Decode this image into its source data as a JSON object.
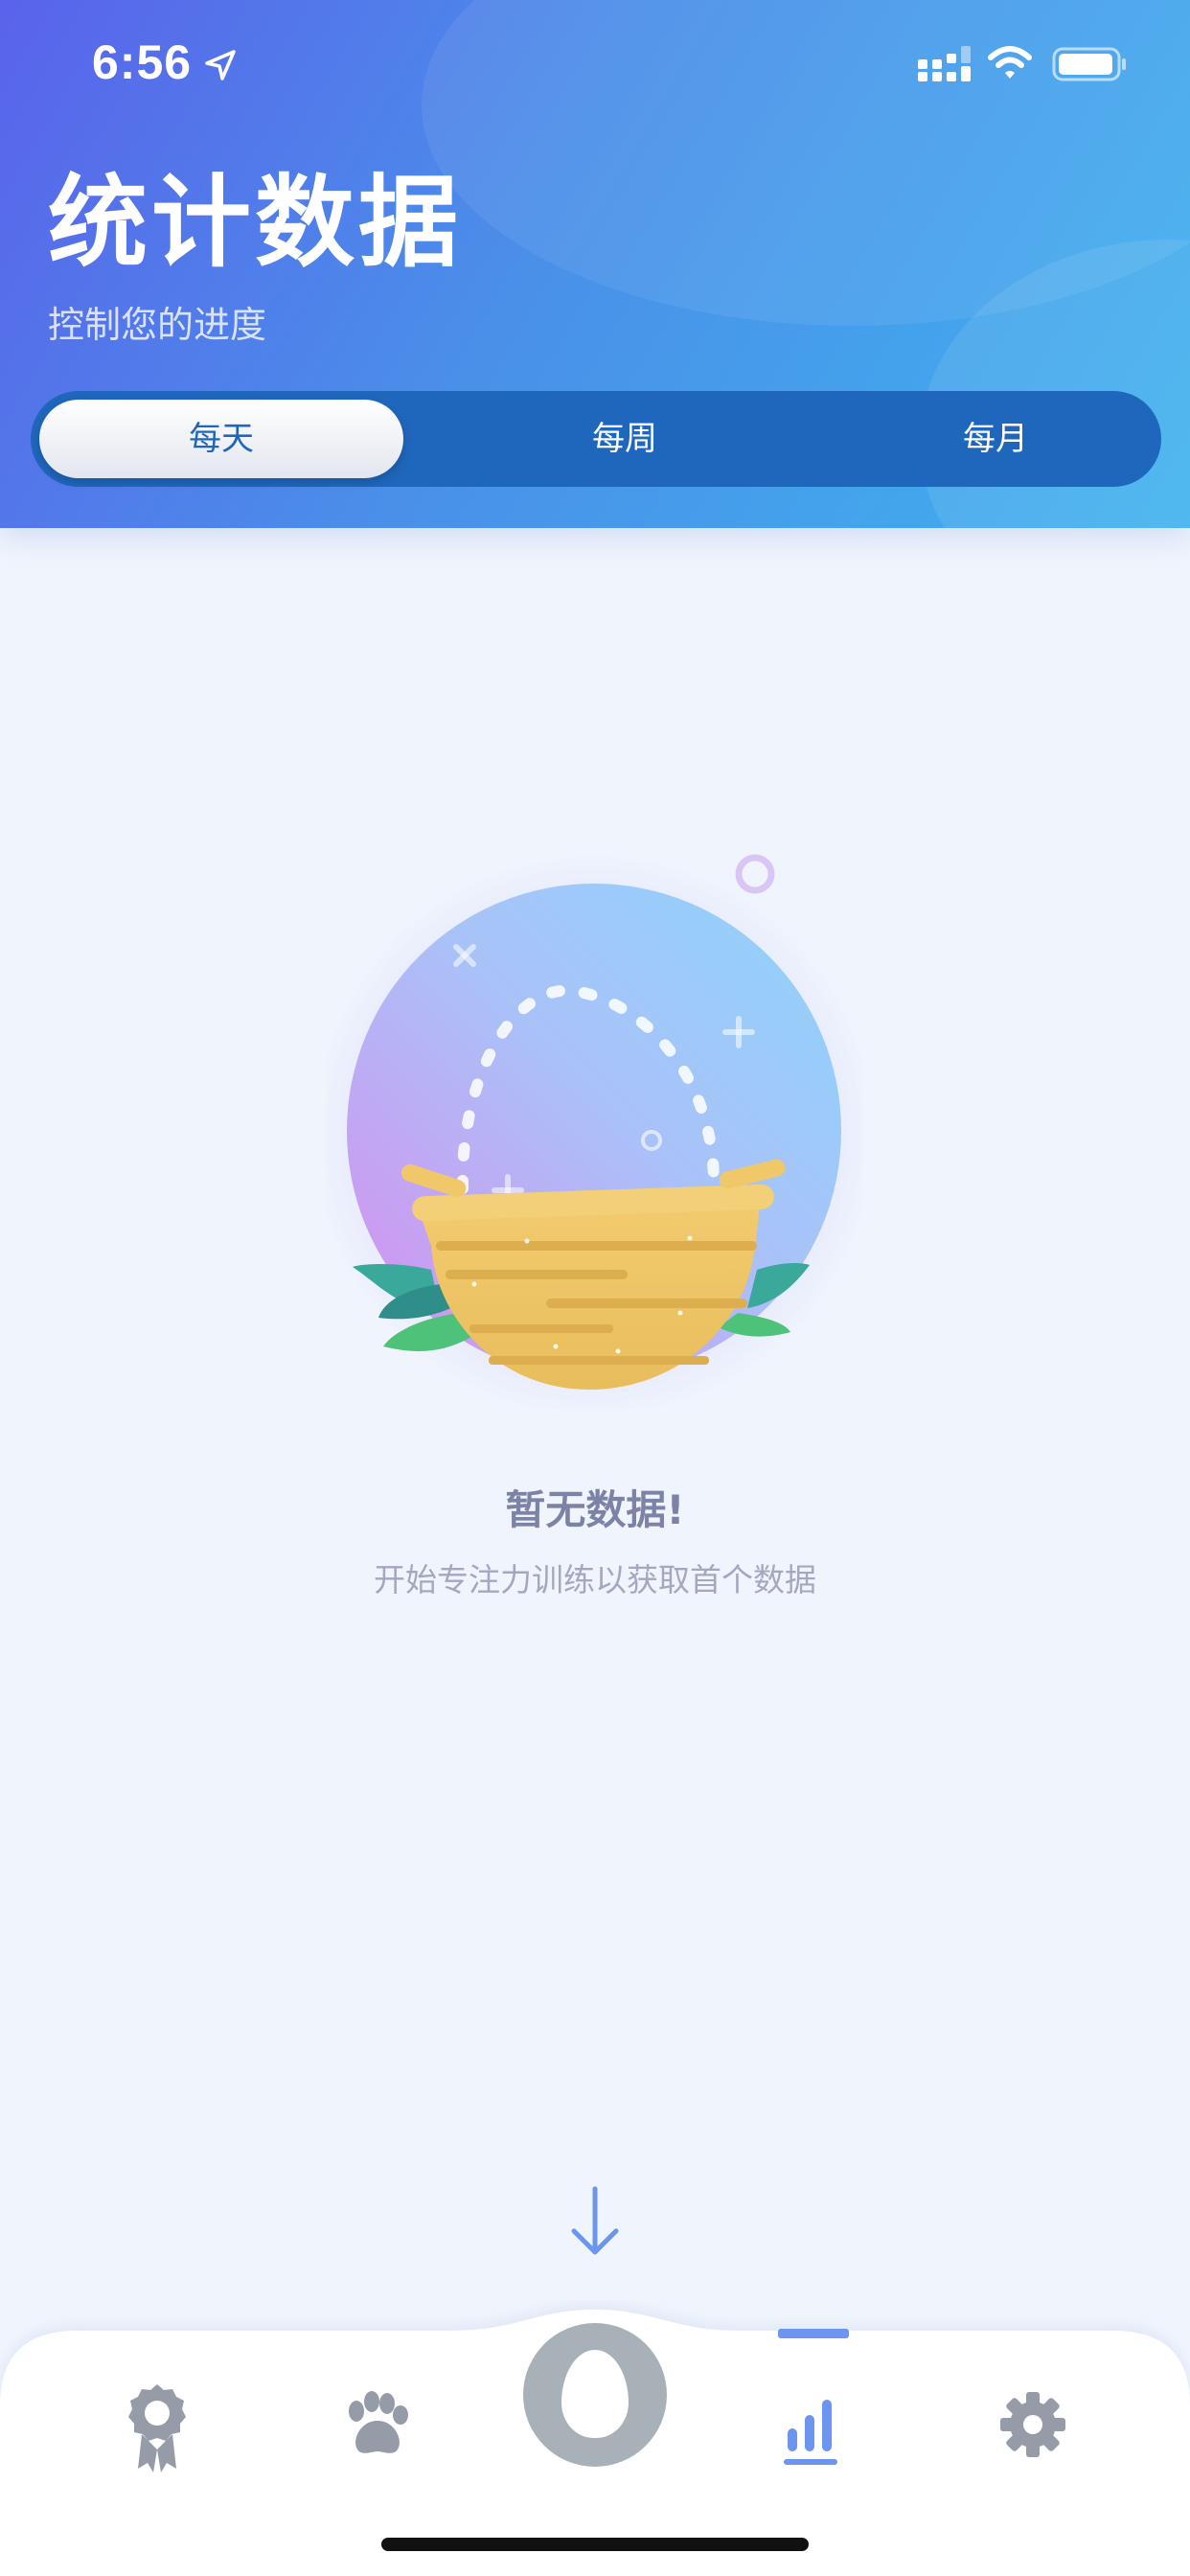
{
  "status_bar": {
    "time": "6:56"
  },
  "header": {
    "title": "统计数据",
    "subtitle": "控制您的进度"
  },
  "segments": {
    "items": [
      "每天",
      "每周",
      "每月"
    ],
    "selected": "每天"
  },
  "empty_state": {
    "title": "暂无数据!",
    "description": "开始专注力训练以获取首个数据"
  },
  "tabbar": {
    "active_index": 3,
    "icons": [
      "badge-icon",
      "paw-icon",
      "egg-icon",
      "bar-chart-icon",
      "gear-icon"
    ]
  },
  "colors": {
    "header_gradient_start": "#5a63eb",
    "header_gradient_end": "#3fb2ee",
    "segment_track": "#1f67bd",
    "page_background": "#f0f5fd",
    "tab_active": "#6b95ef",
    "tab_inactive": "#959ca8"
  }
}
